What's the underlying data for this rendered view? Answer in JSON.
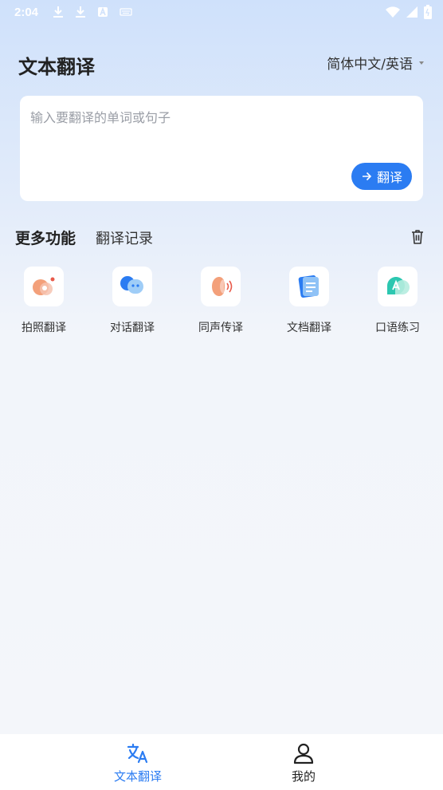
{
  "status_bar": {
    "time": "2:04"
  },
  "header": {
    "title": "文本翻译",
    "language": "简体中文/英语"
  },
  "input": {
    "placeholder": "输入要翻译的单词或句子",
    "translate_label": "翻译"
  },
  "tabs": {
    "more": "更多功能",
    "history": "翻译记录"
  },
  "features": [
    {
      "label": "拍照翻译",
      "icon": "camera-translate-icon"
    },
    {
      "label": "对话翻译",
      "icon": "dialog-translate-icon"
    },
    {
      "label": "同声传译",
      "icon": "simultaneous-interpret-icon"
    },
    {
      "label": "文档翻译",
      "icon": "document-translate-icon"
    },
    {
      "label": "口语练习",
      "icon": "speaking-practice-icon"
    }
  ],
  "bottom_nav": [
    {
      "label": "文本翻译",
      "icon": "translate-icon",
      "active": true
    },
    {
      "label": "我的",
      "icon": "user-icon",
      "active": false
    }
  ],
  "colors": {
    "accent": "#2b7cf2",
    "text": "#222222"
  }
}
